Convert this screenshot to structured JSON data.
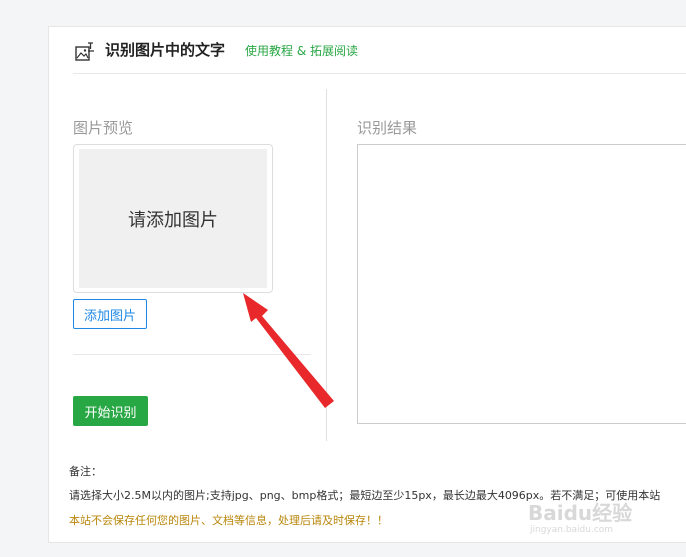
{
  "header": {
    "title": "识别图片中的文字",
    "link": "使用教程 & 拓展阅读"
  },
  "preview": {
    "label": "图片预览",
    "placeholder": "请添加图片",
    "add_button": "添加图片"
  },
  "start_button": "开始识别",
  "result": {
    "label": "识别结果",
    "value": ""
  },
  "notes": {
    "title": "备注：",
    "text": "请选择大小2.5M以内的图片;支持jpg、png、bmp格式；最短边至少15px，最长边最大4096px。若不满足；可使用本站",
    "warning": "本站不会保存任何您的图片、文档等信息，处理后请及时保存！！"
  },
  "watermark": {
    "brand": "Baidu经验",
    "url": "jingyan.baidu.com"
  },
  "colors": {
    "accent_green": "#28a745",
    "accent_blue": "#1e88e5",
    "arrow_red": "#e8282b",
    "warning": "#b8860b"
  }
}
